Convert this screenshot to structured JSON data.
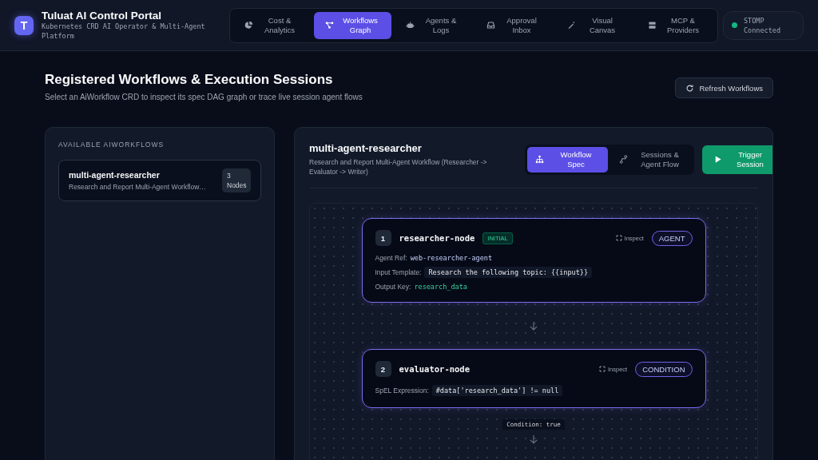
{
  "app": {
    "logo": "T",
    "title": "Tuluat AI Control Portal",
    "subtitle": "Kubernetes CRD AI Operator & Multi-Agent Platform"
  },
  "nav": [
    {
      "kind": "cost",
      "label": "Cost & Analytics",
      "selected": false
    },
    {
      "kind": "graph",
      "label": "Workflows Graph",
      "selected": true
    },
    {
      "kind": "agents",
      "label": "Agents & Logs",
      "selected": false
    },
    {
      "kind": "inbox",
      "label": "Approval Inbox",
      "selected": false
    },
    {
      "kind": "canvas",
      "label": "Visual Canvas",
      "selected": false
    },
    {
      "kind": "providers",
      "label": "MCP & Providers",
      "selected": false
    }
  ],
  "connection": {
    "label": "STOMP Connected",
    "connected": true
  },
  "page": {
    "title": "Registered Workflows & Execution Sessions",
    "subtitle": "Select an AiWorkflow CRD to inspect its spec DAG graph or trace live session agent flows",
    "refresh": "Refresh Workflows"
  },
  "workflows": {
    "heading": "AVAILABLE AIWORKFLOWS",
    "items": [
      {
        "name": "multi-agent-researcher",
        "description": "Research and Report Multi-Agent Workflow…",
        "nodes": "3 Nodes",
        "selected": true
      }
    ]
  },
  "detail": {
    "title": "multi-agent-researcher",
    "description": "Research and Report Multi-Agent Workflow (Researcher -> Evaluator -> Writer)",
    "views": [
      {
        "kind": "spec",
        "label": "Workflow Spec",
        "selected": true
      },
      {
        "kind": "sessions",
        "label": "Sessions & Agent Flow",
        "selected": false
      }
    ],
    "trigger": "Trigger Session",
    "nodes": [
      {
        "index": "1",
        "name": "researcher-node",
        "tag": "INITIAL",
        "inspect": "Inspect",
        "type": "AGENT",
        "fields": [
          {
            "label": "Agent Ref:",
            "value": "web-researcher-agent",
            "kind": "ref"
          },
          {
            "label": "Input Template:",
            "value": "Research the following topic: {{input}}",
            "kind": "code"
          },
          {
            "label": "Output Key:",
            "value": "research_data",
            "kind": "key"
          }
        ]
      },
      {
        "index": "2",
        "name": "evaluator-node",
        "inspect": "Inspect",
        "type": "CONDITION",
        "edge_label": "Condition: true",
        "fields": [
          {
            "label": "SpEL Expression:",
            "value": "#data['research_data'] != null",
            "kind": "code"
          }
        ]
      }
    ]
  }
}
